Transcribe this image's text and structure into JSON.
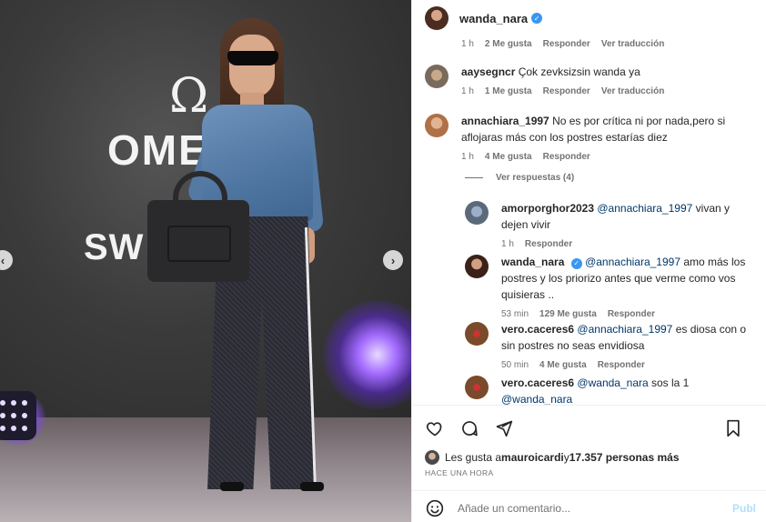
{
  "post": {
    "username": "wanda_nara",
    "verified": true
  },
  "photo": {
    "brand_symbol": "Ω",
    "brand_text_1": "OME",
    "brand_text_2": "SW"
  },
  "comments": [
    {
      "user": "",
      "text": "",
      "time": "1 h",
      "likes": "2 Me gusta",
      "reply": "Responder",
      "translate": "Ver traducción",
      "clipped": true
    },
    {
      "user": "aaysegncr",
      "text": "Çok zevksizsin wanda ya",
      "time": "1 h",
      "likes": "1 Me gusta",
      "reply": "Responder",
      "translate": "Ver traducción"
    },
    {
      "user": "annachiara_1997",
      "text": "No es por crítica ni por nada,pero si aflojaras más con los postres estarías diez",
      "time": "1 h",
      "likes": "4 Me gusta",
      "reply": "Responder"
    }
  ],
  "view_replies": "Ver respuestas (4)",
  "replies": [
    {
      "user": "amorporghor2023",
      "mention": "@annachiara_1997",
      "text": " vivan y dejen vivir",
      "time": "1 h",
      "reply": "Responder"
    },
    {
      "user": "wanda_nara",
      "verified": true,
      "mention": "@annachiara_1997",
      "text": " amo más los postres y los priorizo antes que verme como vos quisieras ..",
      "time": "53 min",
      "likes": "129 Me gusta",
      "reply": "Responder"
    },
    {
      "user": "vero.caceres6",
      "mention": "@annachiara_1997",
      "text": " es diosa con o sin postres no seas envidiosa",
      "time": "50 min",
      "likes": "4 Me gusta",
      "reply": "Responder"
    },
    {
      "user": "vero.caceres6",
      "mention": "@wanda_nara",
      "text_mid": " sos la 1 ",
      "mention2": "@wanda_nara",
      "emoji": "❤"
    }
  ],
  "likes_line": {
    "prefix": "Les gusta a ",
    "user": "mauroicardi",
    "middle": " y ",
    "count": "17.357 personas más"
  },
  "timestamp": "HACE UNA HORA",
  "add_comment": {
    "placeholder": "Añade un comentario...",
    "publish": "Publ"
  },
  "icons": [
    "heart-icon",
    "comment-icon",
    "share-icon",
    "bookmark-icon",
    "emoji-icon",
    "chevron-left-icon",
    "chevron-right-icon"
  ],
  "colors": {
    "link": "#00376b",
    "verified": "#3897f0",
    "muted": "#737373",
    "publish": "#b2dffc",
    "heart": "#ed4956"
  }
}
